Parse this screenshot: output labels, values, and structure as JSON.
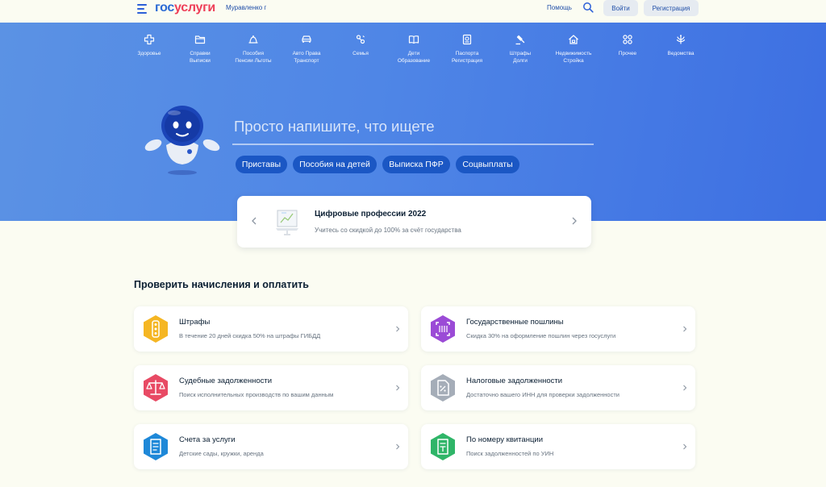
{
  "header": {
    "logo_part1": "гос",
    "logo_part2": "услуги",
    "city": "Муравленко г",
    "help": "Помощь",
    "login": "Войти",
    "register": "Регистрация"
  },
  "categories": [
    {
      "line1": "Здоровье",
      "line2": "",
      "icon": "health-cross-icon"
    },
    {
      "line1": "Справки",
      "line2": "Выписки",
      "icon": "folder-icon"
    },
    {
      "line1": "Пособия",
      "line2": "Пенсии Льготы",
      "icon": "benefits-icon"
    },
    {
      "line1": "Авто Права",
      "line2": "Транспорт",
      "icon": "car-icon"
    },
    {
      "line1": "Семья",
      "line2": "",
      "icon": "family-icon"
    },
    {
      "line1": "Дети",
      "line2": "Образование",
      "icon": "book-icon"
    },
    {
      "line1": "Паспорта",
      "line2": "Регистрация",
      "icon": "passport-icon"
    },
    {
      "line1": "Штрафы",
      "line2": "Долги",
      "icon": "gavel-icon"
    },
    {
      "line1": "Недвижимость",
      "line2": "Стройка",
      "icon": "house-icon"
    },
    {
      "line1": "Прочее",
      "line2": "",
      "icon": "grid-icon"
    },
    {
      "line1": "Ведомства",
      "line2": "",
      "icon": "emblem-icon"
    }
  ],
  "search": {
    "placeholder": "Просто напишите, что ищете"
  },
  "chips": [
    "Приставы",
    "Пособия на детей",
    "Выписка ПФР",
    "Соцвыплаты"
  ],
  "banner": {
    "title": "Цифровые профессии 2022",
    "subtitle": "Учитесь со скидкой до 100% за счёт государства"
  },
  "section": {
    "title": "Проверить начисления и оплатить"
  },
  "cards": [
    {
      "title": "Штрафы",
      "subtitle": "В течение 20 дней скидка 50% на штрафы ГИБДД",
      "color": "#f5b623",
      "icon": "traffic-light-icon"
    },
    {
      "title": "Государственные пошлины",
      "subtitle": "Скидка 30% на оформление пошлин через госуслуги",
      "color": "#9b4bd6",
      "icon": "scan-icon"
    },
    {
      "title": "Судебные задолженности",
      "subtitle": "Поиск исполнительных производств по вашим данным",
      "color": "#e84a64",
      "icon": "scales-icon"
    },
    {
      "title": "Налоговые задолженности",
      "subtitle": "Достаточно вашего ИНН для проверки задолженности",
      "color": "#a5adb8",
      "icon": "tax-document-icon"
    },
    {
      "title": "Счета за услуги",
      "subtitle": "Детские сады, кружки, аренда",
      "color": "#1e88d8",
      "icon": "bill-icon"
    },
    {
      "title": "По номеру квитанции",
      "subtitle": "Поиск задолженностей по УИН",
      "color": "#2fb568",
      "icon": "receipt-icon"
    }
  ]
}
